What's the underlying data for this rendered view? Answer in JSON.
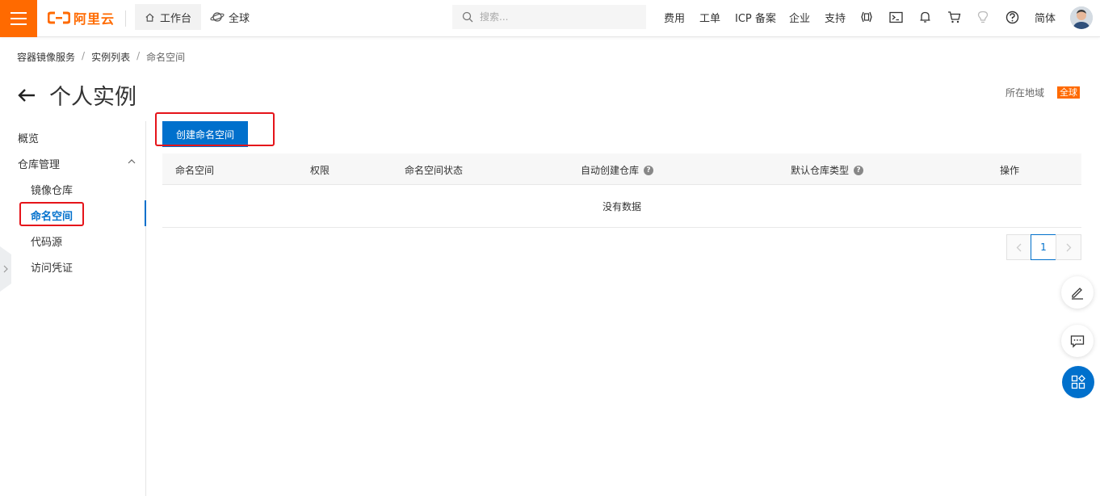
{
  "topbar": {
    "logo_text": "阿里云",
    "workbench": "工作台",
    "global": "全球",
    "search_placeholder": "搜索...",
    "menu": [
      "费用",
      "工单",
      "ICP 备案",
      "企业",
      "支持"
    ],
    "lang": "简体"
  },
  "breadcrumb": {
    "items": [
      "容器镜像服务",
      "实例列表",
      "命名空间"
    ],
    "sep": "/"
  },
  "page": {
    "title": "个人实例",
    "region_label": "所在地域",
    "region_badge": "全球"
  },
  "sidebar": {
    "items": [
      "概览",
      "仓库管理",
      "镜像仓库",
      "命名空间",
      "代码源",
      "访问凭证"
    ]
  },
  "main": {
    "create_button": "创建命名空间",
    "columns": [
      "命名空间",
      "权限",
      "命名空间状态",
      "自动创建仓库",
      "默认仓库类型",
      "操作"
    ],
    "empty_text": "没有数据",
    "pagination": {
      "current_page": "1"
    }
  },
  "colors": {
    "brand": "#ff6a00",
    "primary": "#0070cc",
    "highlight": "#e5141a"
  },
  "icons": [
    "menu-icon",
    "home-icon",
    "globe-icon",
    "search-icon",
    "api-icon",
    "terminal-icon",
    "bell-icon",
    "cart-icon",
    "lightbulb-icon",
    "help-icon",
    "back-arrow-icon",
    "chevron-up-icon",
    "chevron-right-icon",
    "question-icon",
    "edit-icon",
    "chat-icon",
    "apps-icon"
  ]
}
